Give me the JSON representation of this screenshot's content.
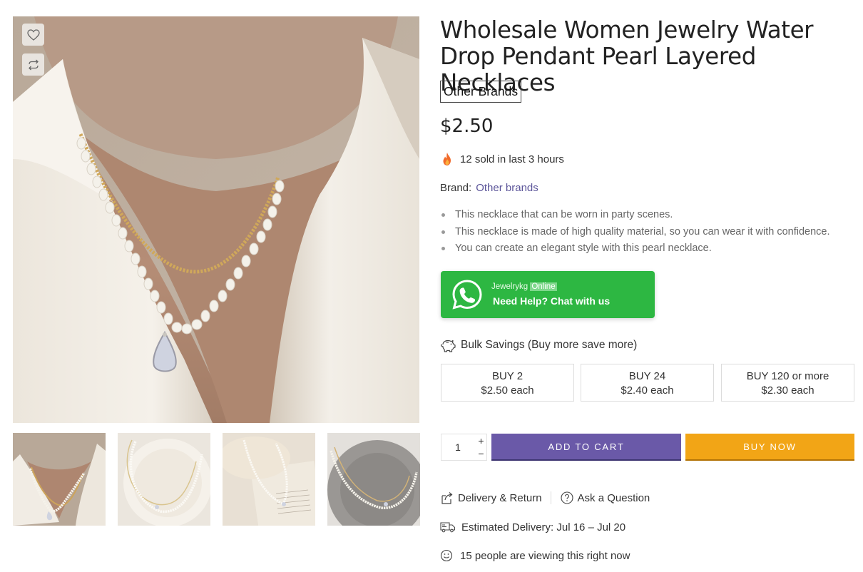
{
  "product": {
    "title": "Wholesale Women Jewelry Water Drop Pendant Pearl Layered Necklaces",
    "brand_tag": "Other Brands",
    "price": "$2.50",
    "sold_text": "12 sold in last 3 hours",
    "brand_label": "Brand:",
    "brand_link": "Other brands",
    "features": [
      "This necklace that can be worn in party scenes.",
      "This necklace is made of high quality material, so you can wear it with confidence.",
      "You can create an elegant style with this pearl necklace."
    ]
  },
  "gallery": {
    "actions": {
      "wishlist_icon": "heart-icon",
      "compare_icon": "arrows-loop-icon"
    },
    "thumbnails": [
      "necklace-on-model",
      "necklace-flatlay-cream",
      "necklace-on-paper",
      "necklace-on-grey-plate"
    ]
  },
  "whatsapp": {
    "name": "Jewelrykg",
    "status": "Online",
    "cta": "Need Help? Chat with us",
    "color": "#2db742"
  },
  "bulk": {
    "heading": "Bulk Savings (Buy more save more)",
    "tiers": [
      {
        "qty": "BUY 2",
        "price": "$2.50 each"
      },
      {
        "qty": "BUY 24",
        "price": "$2.40 each"
      },
      {
        "qty": "BUY 120 or more",
        "price": "$2.30 each"
      }
    ]
  },
  "cart": {
    "quantity": "1",
    "plus": "+",
    "minus": "−",
    "add_to_cart": "ADD TO CART",
    "buy_now": "BUY NOW",
    "add_color": "#6a59a8",
    "buy_color": "#f2a516"
  },
  "info": {
    "delivery_return": "Delivery & Return",
    "ask_question": "Ask a Question",
    "estimated_delivery": "Estimated Delivery: Jul 16 – Jul 20",
    "viewers": "15 people are viewing this right now"
  }
}
